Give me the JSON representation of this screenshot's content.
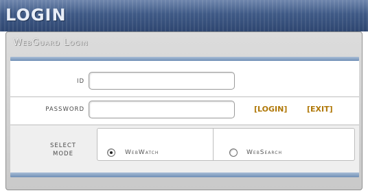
{
  "header": {
    "title": "LOGIN"
  },
  "panel": {
    "title": "WebGuard Login"
  },
  "form": {
    "id_label": "ID",
    "id_value": "",
    "password_label": "PASSWORD",
    "password_value": "",
    "login_label": "[LOGIN]",
    "exit_label": "[EXIT]"
  },
  "mode": {
    "label_line1": "SELECT",
    "label_line2": "MODE",
    "options": [
      {
        "label": "WebWatch",
        "selected": true
      },
      {
        "label": "WebSearch",
        "selected": false
      }
    ]
  },
  "colors": {
    "header_bg": "#3f5a86",
    "accent_bar": "#6f8fb6",
    "action_link": "#b07808",
    "panel_bg": "#d2d2d2"
  }
}
